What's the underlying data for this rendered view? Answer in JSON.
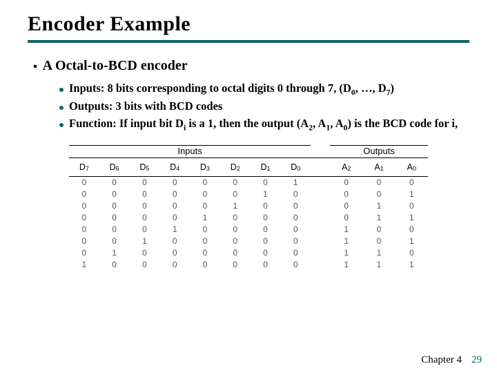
{
  "title": "Encoder Example",
  "section": {
    "heading": "A Octal-to-BCD encoder",
    "points": {
      "p1_a": "Inputs: 8 bits corresponding to octal digits 0 through 7, (D",
      "p1_b": ", …, D",
      "p1_c": ")",
      "p2": "Outputs: 3 bits with BCD codes",
      "p3_a": "Function: If input bit D",
      "p3_b": " is a 1, then the output (A",
      "p3_c": ", A",
      "p3_d": ", A",
      "p3_e": ") is the BCD code for i,"
    }
  },
  "chart_data": {
    "type": "table",
    "title": "",
    "groups": {
      "inputs": "Inputs",
      "outputs": "Outputs"
    },
    "input_headers": [
      "D7",
      "D6",
      "D5",
      "D4",
      "D3",
      "D2",
      "D1",
      "D0"
    ],
    "output_headers": [
      "A2",
      "A1",
      "A0"
    ],
    "rows": [
      {
        "in": [
          0,
          0,
          0,
          0,
          0,
          0,
          0,
          1
        ],
        "out": [
          0,
          0,
          0
        ]
      },
      {
        "in": [
          0,
          0,
          0,
          0,
          0,
          0,
          1,
          0
        ],
        "out": [
          0,
          0,
          1
        ]
      },
      {
        "in": [
          0,
          0,
          0,
          0,
          0,
          1,
          0,
          0
        ],
        "out": [
          0,
          1,
          0
        ]
      },
      {
        "in": [
          0,
          0,
          0,
          0,
          1,
          0,
          0,
          0
        ],
        "out": [
          0,
          1,
          1
        ]
      },
      {
        "in": [
          0,
          0,
          0,
          1,
          0,
          0,
          0,
          0
        ],
        "out": [
          1,
          0,
          0
        ]
      },
      {
        "in": [
          0,
          0,
          1,
          0,
          0,
          0,
          0,
          0
        ],
        "out": [
          1,
          0,
          1
        ]
      },
      {
        "in": [
          0,
          1,
          0,
          0,
          0,
          0,
          0,
          0
        ],
        "out": [
          1,
          1,
          0
        ]
      },
      {
        "in": [
          1,
          0,
          0,
          0,
          0,
          0,
          0,
          0
        ],
        "out": [
          1,
          1,
          1
        ]
      }
    ]
  },
  "footer": {
    "chapter": "Chapter 4",
    "page": "29"
  }
}
